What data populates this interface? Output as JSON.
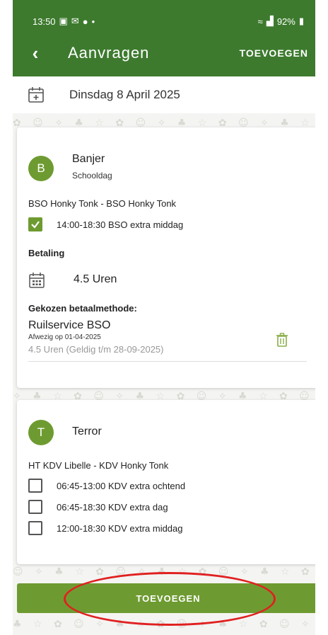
{
  "status_bar": {
    "time": "13:50",
    "signal": "92%"
  },
  "header": {
    "back_icon": "back-arrow-icon",
    "title": "Aanvragen",
    "add_label": "TOEVOEGEN"
  },
  "date": {
    "icon": "calendar-add-icon",
    "text": "Dinsdag 8 April 2025"
  },
  "children": [
    {
      "initial": "B",
      "name": "Banjer",
      "subtitle": "Schooldag",
      "location": "BSO Honky Tonk - BSO Honky Tonk",
      "options": [
        {
          "label": "14:00-18:30 BSO extra middag",
          "checked": true
        }
      ],
      "payment": {
        "heading": "Betaling",
        "hours_icon": "calendar-grid-icon",
        "hours": "4.5 Uren",
        "method_heading": "Gekozen betaalmethode:",
        "method_name": "Ruilservice BSO",
        "absent": "Afwezig op 01-04-2025",
        "validity": "4.5 Uren (Geldig t/m 28-09-2025)",
        "delete_icon": "trash-icon"
      }
    },
    {
      "initial": "T",
      "name": "Terror",
      "location": "HT KDV Libelle - KDV Honky Tonk",
      "options": [
        {
          "label": "06:45-13:00 KDV extra ochtend",
          "checked": false
        },
        {
          "label": "06:45-18:30 KDV extra dag",
          "checked": false
        },
        {
          "label": "12:00-18:30 KDV extra middag",
          "checked": false
        }
      ]
    }
  ],
  "bottom_button": {
    "label": "TOEVOEGEN"
  },
  "colors": {
    "header": "#3d7a2e",
    "accent": "#6e9b31",
    "highlight": "#e02020"
  }
}
